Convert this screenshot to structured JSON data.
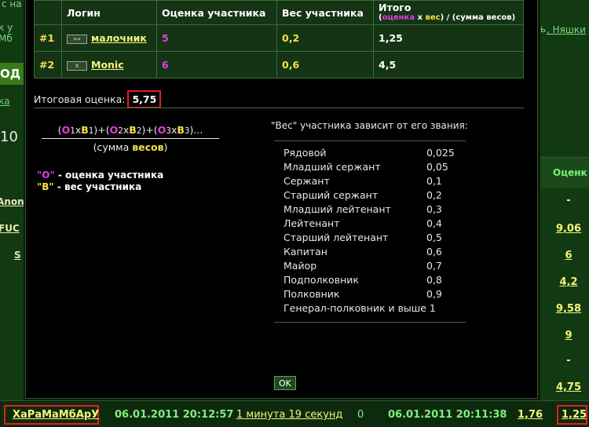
{
  "background": {
    "left_fragments": [
      "с на",
      "к у",
      "Мб",
      "ОД",
      "ка",
      "10",
      "Anon",
      "FUC",
      "S"
    ],
    "right_links": ", Няшки",
    "right_link_prefix": "ь",
    "right_column_header": "Оценк",
    "right_column_values": [
      "-",
      "9,06",
      "6",
      "4,2",
      "9,58",
      "9",
      "-",
      "4,75"
    ],
    "right_column_last": "1,25",
    "bottom_row": {
      "user": "ХаРаМаМбАрУ",
      "datetime1": "06.01.2011 20:12:57",
      "duration": "1 минута 19 секунд",
      "count": "0",
      "datetime2": "06.01.2011 20:11:38",
      "score": "1,76"
    }
  },
  "modal": {
    "table": {
      "headers": {
        "login": "Логин",
        "score": "Оценка участника",
        "weight": "Вес участника",
        "total": "Итого",
        "total_sub_open": "(",
        "total_sub_score": "оценка",
        "total_sub_x": " х ",
        "total_sub_weight": "вес",
        "total_sub_rest": ") / (сумма весов)"
      },
      "rows": [
        {
          "num": "#1",
          "rank_icon": "»»",
          "login": "малочник",
          "score": "5",
          "weight": "0,2",
          "total": "1,25"
        },
        {
          "num": "#2",
          "rank_icon": "x",
          "login": "Monic",
          "score": "6",
          "weight": "0,6",
          "total": "4,5"
        }
      ]
    },
    "total_label": "Итоговая оценка:",
    "total_value": "5,75",
    "formula": {
      "p1": "(",
      "o1": "О",
      "i1": "1",
      "x1": "х",
      "b1": "В",
      "j1": "1",
      "p2": ")+(",
      "o2": "О",
      "i2": "2",
      "x2": "х",
      "b2": "В",
      "j2": "2",
      "p3": ")+(",
      "o3": "О",
      "i3": "3",
      "x3": "х",
      "b3": "В",
      "j3": "3",
      "p4": ")...",
      "den_open": "(сумма ",
      "den_word": "весов",
      "den_close": ")"
    },
    "legend": {
      "o_key": "\"О\"",
      "o_text": " - оценка участника",
      "v_key": "\"В\"",
      "v_text": " - вес участника"
    },
    "rank_title": "\"Вес\" участника зависит от его звания:",
    "ranks": [
      {
        "name": "Рядовой",
        "weight": "0,025"
      },
      {
        "name": "Младший сержант",
        "weight": "0,05"
      },
      {
        "name": "Сержант",
        "weight": "0,1"
      },
      {
        "name": "Старший сержант",
        "weight": "0,2"
      },
      {
        "name": "Младший лейтенант",
        "weight": "0,3"
      },
      {
        "name": "Лейтенант",
        "weight": "0,4"
      },
      {
        "name": "Старший лейтенант",
        "weight": "0,5"
      },
      {
        "name": "Капитан",
        "weight": "0,6"
      },
      {
        "name": "Майор",
        "weight": "0,7"
      },
      {
        "name": "Подполковник",
        "weight": "0,8"
      },
      {
        "name": "Полковник",
        "weight": "0,9"
      },
      {
        "name": "Генерал-полковник и выше 1",
        "weight": ""
      }
    ],
    "ok_label": "OK"
  }
}
